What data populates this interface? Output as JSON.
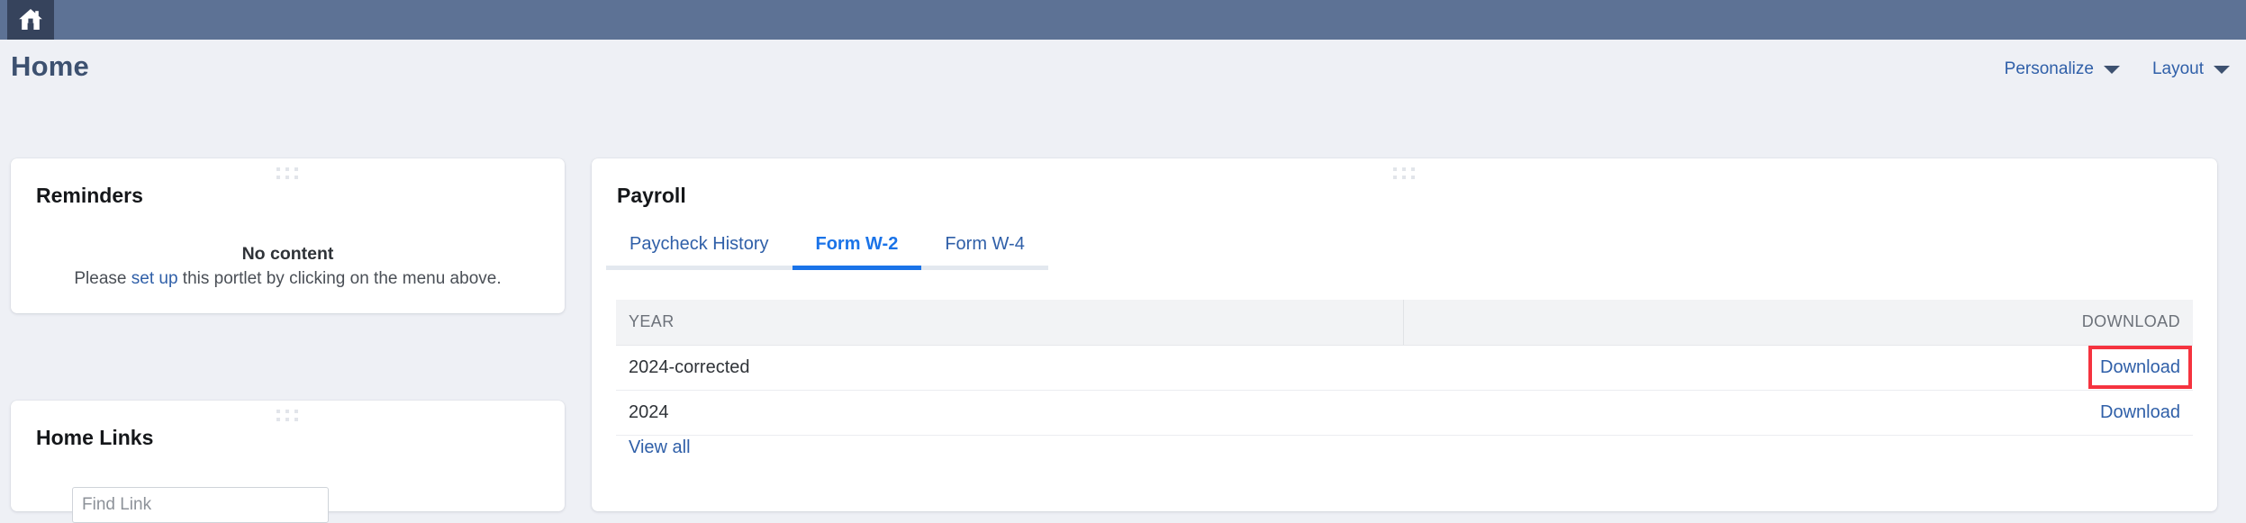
{
  "topbar": {
    "home_icon": "home-icon"
  },
  "header": {
    "title": "Home",
    "actions": [
      {
        "label": "Personalize",
        "icon": "chevron-down-icon"
      },
      {
        "label": "Layout",
        "icon": "chevron-down-icon"
      }
    ]
  },
  "reminders": {
    "title": "Reminders",
    "empty_title": "No content",
    "empty_text_before": "Please ",
    "empty_link": "set up",
    "empty_text_after": " this portlet by clicking on the menu above."
  },
  "home_links": {
    "title": "Home Links",
    "find_link_placeholder": "Find Link",
    "find_link_value": ""
  },
  "payroll": {
    "title": "Payroll",
    "tabs": [
      {
        "label": "Paycheck History",
        "active": false
      },
      {
        "label": "Form W-2",
        "active": true
      },
      {
        "label": "Form W-4",
        "active": false
      }
    ],
    "table": {
      "columns": [
        "YEAR",
        "DOWNLOAD"
      ],
      "rows": [
        {
          "year": "2024-corrected",
          "download": "Download",
          "highlighted": true
        },
        {
          "year": "2024",
          "download": "Download",
          "highlighted": false
        }
      ]
    },
    "view_all": "View all"
  },
  "colors": {
    "topbar": "#5d7295",
    "home_tile": "#36435c",
    "page_background": "#eef0f5",
    "title": "#3d5170",
    "link": "#2f5fa8",
    "active_tab": "#1a73e8",
    "highlight_box": "#f5333f",
    "table_header_bg": "#f2f3f5"
  }
}
